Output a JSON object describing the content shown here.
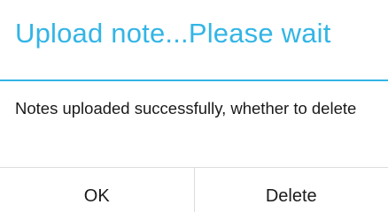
{
  "dialog": {
    "title": "Upload note...Please wait",
    "message": "Notes uploaded successfully, whether to delete",
    "buttons": {
      "ok_label": "OK",
      "delete_label": "Delete"
    },
    "colors": {
      "accent": "#33b5e5",
      "text": "#1a1a1a",
      "divider": "#dcdcdc",
      "background": "#ffffff"
    }
  }
}
